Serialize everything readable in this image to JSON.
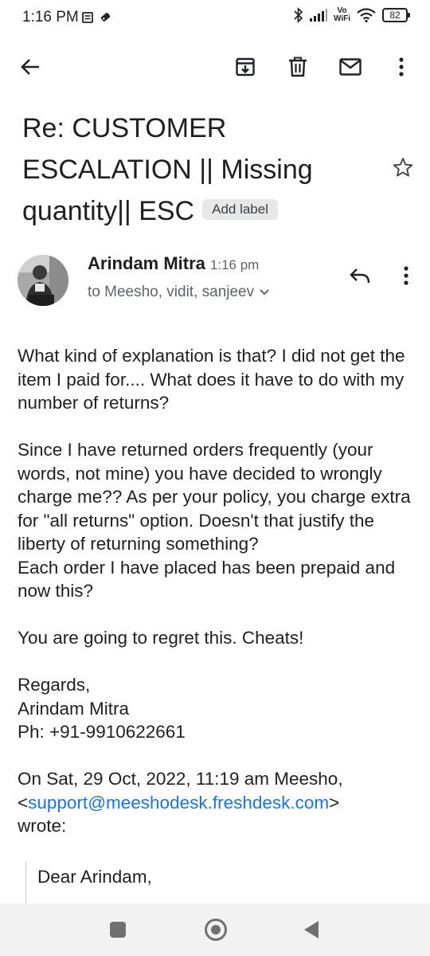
{
  "status_bar": {
    "time": "1:16 PM",
    "vo_label": "Vo",
    "wifi_label": "WiFi",
    "battery": "82"
  },
  "app_bar": {
    "icons": [
      "back-arrow-icon",
      "archive-icon",
      "delete-icon",
      "mail-icon",
      "more-vert-icon"
    ]
  },
  "email": {
    "subject": "Re: CUSTOMER ESCALATION || Missing quantity|| ESC",
    "add_label": "Add label",
    "sender_name": "Arindam Mitra",
    "time": "1:16 pm",
    "recipients": "to Meesho, vidit, sanjeev",
    "body": {
      "p1": "What kind of explanation is that? I did not get the item I paid for.... What does it have to do with my number of returns?",
      "p2": "Since I have returned orders frequently (your words, not mine) you have decided to wrongly charge me?? As per your policy, you charge extra for \"all returns\" option. Doesn't that justify the liberty of returning something?",
      "p3": "Each order I have placed has been prepaid and now this?",
      "p4": "You are going to regret this. Cheats!",
      "regards": "Regards,",
      "sign_name": "Arindam Mitra",
      "phone": "Ph: +91-9910622661",
      "quote_header_prefix": "On Sat, 29 Oct, 2022, 11:19 am Meesho, <",
      "quote_email": "support@meeshodesk.freshdesk.com",
      "quote_header_suffix": ">",
      "wrote": "wrote:",
      "quoted_greeting": "Dear Arindam,"
    }
  },
  "colors": {
    "link": "#1a73e8",
    "text": "#1f1f1f",
    "secondary": "#5f6368"
  }
}
